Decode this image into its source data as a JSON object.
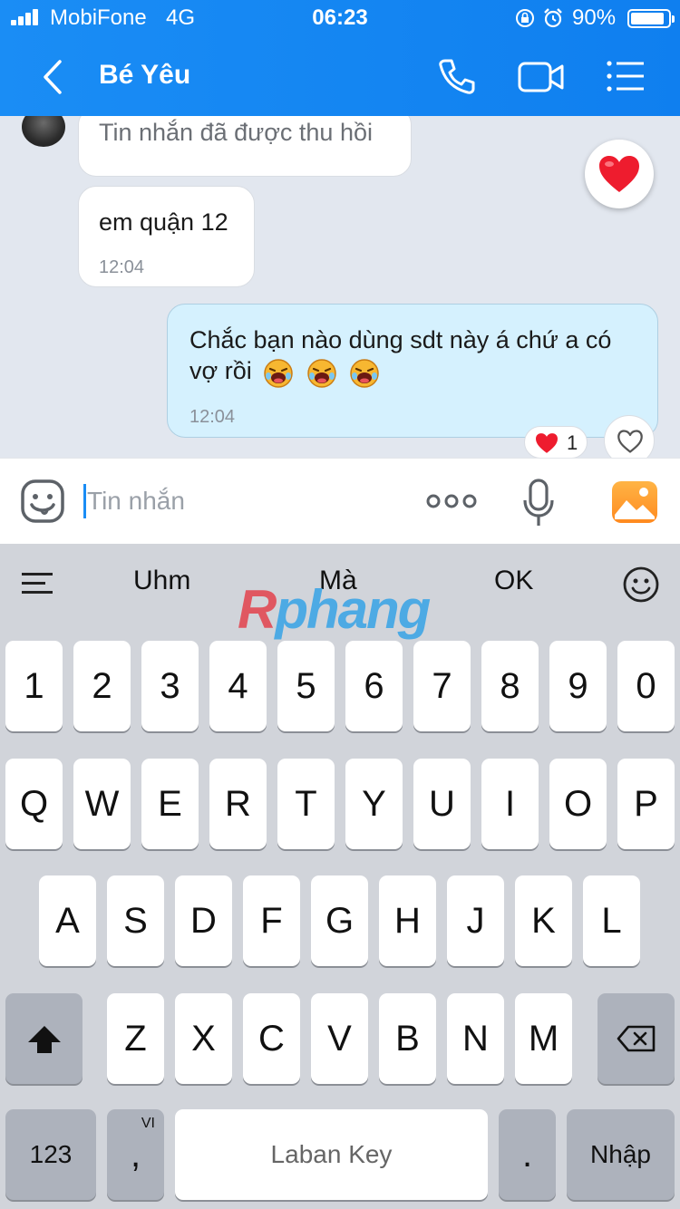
{
  "status_bar": {
    "carrier": "MobiFone",
    "network": "4G",
    "time": "06:23",
    "battery_percent": "90%",
    "battery_level": 0.9
  },
  "header": {
    "title": "Bé Yêu",
    "icons": [
      "back-icon",
      "phone-icon",
      "video-call-icon",
      "menu-list-icon"
    ],
    "background_color": "#1a8df5"
  },
  "messages": [
    {
      "direction": "incoming",
      "text": "Tin nhắn đã được thu hồi",
      "recalled": true
    },
    {
      "direction": "incoming",
      "text": "em quận 12",
      "time": "12:04"
    },
    {
      "direction": "outgoing",
      "text": "Chắc bạn nào dùng sdt này á chứ a có vợ rồi",
      "emoji": [
        "laughing-emoji",
        "laughing-emoji",
        "laughing-emoji"
      ],
      "time": "12:04",
      "reaction": {
        "icon": "heart-icon",
        "count": "1"
      }
    }
  ],
  "composer": {
    "placeholder": "Tin nhắn",
    "icons": [
      "sticker-icon",
      "more-icon",
      "mic-icon",
      "photo-icon"
    ]
  },
  "keyboard": {
    "suggestions": [
      "Uhm",
      "Mà",
      "OK"
    ],
    "watermark": "Rphang",
    "row_numbers": [
      "1",
      "2",
      "3",
      "4",
      "5",
      "6",
      "7",
      "8",
      "9",
      "0"
    ],
    "row_1": [
      "Q",
      "W",
      "E",
      "R",
      "T",
      "Y",
      "U",
      "I",
      "O",
      "P"
    ],
    "row_2": [
      "A",
      "S",
      "D",
      "F",
      "G",
      "H",
      "J",
      "K",
      "L"
    ],
    "row_3": [
      "Z",
      "X",
      "C",
      "V",
      "B",
      "N",
      "M"
    ],
    "numbers_key": "123",
    "comma_key": ",",
    "comma_hint": "VI",
    "space_label": "Laban Key",
    "period_key": ".",
    "enter_label": "Nhập"
  }
}
